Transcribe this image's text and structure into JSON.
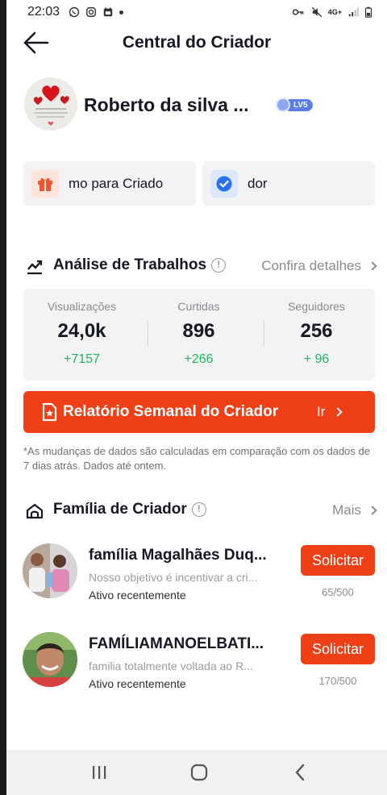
{
  "status_bar": {
    "time": "22:03",
    "network": "4G+"
  },
  "header": {
    "title": "Central do Criador"
  },
  "profile": {
    "name": "Roberto da silva ...",
    "level": "LV5"
  },
  "shortcuts": [
    {
      "label": "mo para Criado",
      "icon": "gift-icon"
    },
    {
      "label": "dor",
      "icon": "verified-check-icon"
    }
  ],
  "analysis": {
    "title": "Análise de Trabalhos",
    "link_label": "Confira detalhes",
    "stats": [
      {
        "label": "Visualizações",
        "value": "24,0k",
        "delta": "+7157"
      },
      {
        "label": "Curtidas",
        "value": "896",
        "delta": "+266"
      },
      {
        "label": "Seguidores",
        "value": "256",
        "delta": "+ 96"
      }
    ],
    "report": {
      "label": "Relatório Semanal do Criador",
      "go_label": "Ir"
    },
    "disclaimer": "*As mudanças de dados são calculadas em comparação com os dados de 7 dias atrás. Dados até ontem."
  },
  "family": {
    "title": "Família de Criador",
    "link_label": "Mais",
    "items": [
      {
        "name": "família Magalhães Duq...",
        "description": "Nosso objetivo é incentivar a cri...",
        "status": "Ativo recentemente",
        "button": "Solicitar",
        "count": "65/500"
      },
      {
        "name": "FAMÍLIAMANOELBATI...",
        "description": "familia totalmente voltada ao R...",
        "status": "Ativo recentemente",
        "button": "Solicitar",
        "count": "170/500"
      }
    ]
  },
  "colors": {
    "accent": "#EE3F17",
    "positive": "#1FB55E",
    "muted_text": "#8A8B91",
    "card_bg": "#F3F3F4"
  }
}
